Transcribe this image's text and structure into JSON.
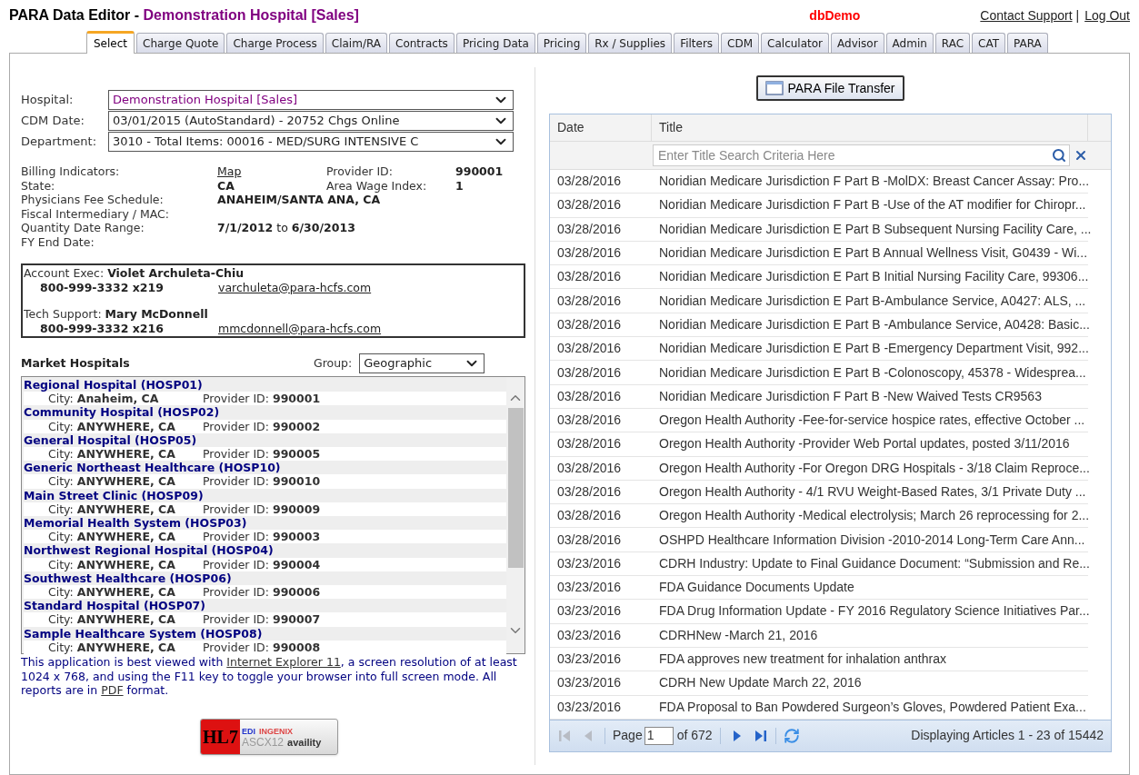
{
  "header": {
    "app_title": "PARA Data Editor - ",
    "hospital_title": "Demonstration Hospital [Sales]",
    "database": "dbDemo",
    "links": [
      {
        "label": "Contact Support"
      },
      {
        "label": "|",
        "kind": "separator"
      },
      {
        "label": "Log Out"
      }
    ]
  },
  "tabs": [
    {
      "label": "Select",
      "selected": true
    },
    {
      "label": "Charge Quote",
      "selected": false
    },
    {
      "label": "Charge Process",
      "selected": false
    },
    {
      "label": "Claim/RA",
      "selected": false
    },
    {
      "label": "Contracts",
      "selected": false
    },
    {
      "label": "Pricing Data",
      "selected": false
    },
    {
      "label": "Pricing",
      "selected": false
    },
    {
      "label": "Rx / Supplies",
      "selected": false
    },
    {
      "label": "Filters",
      "selected": false
    },
    {
      "label": "CDM",
      "selected": false
    },
    {
      "label": "Calculator",
      "selected": false
    },
    {
      "label": "Advisor",
      "selected": false
    },
    {
      "label": "Admin",
      "selected": false
    },
    {
      "label": "RAC",
      "selected": false
    },
    {
      "label": "CAT",
      "selected": false
    },
    {
      "label": "PARA",
      "selected": false
    }
  ],
  "selectors": [
    {
      "label": "Hospital:",
      "value": "Demonstration Hospital [Sales]",
      "kind": "hospital"
    },
    {
      "label": "CDM Date:",
      "value": "03/01/2015 (AutoStandard) - 20752 Chgs Online",
      "kind": "plain"
    },
    {
      "label": "Department:",
      "value": "3010 - Total Items: 00016 - MED/SURG INTENSIVE C",
      "kind": "plain"
    }
  ],
  "info": {
    "rows": [
      {
        "label": "Billing Indicators:",
        "value": "Map",
        "kind": "link",
        "side_label": "Provider ID:",
        "side_value": "990001"
      },
      {
        "label": "State:",
        "value": "CA",
        "kind": "bold",
        "side_label": "Area Wage Index:",
        "side_value": "1"
      },
      {
        "label": "Physicians Fee Schedule:",
        "value": "ANAHEIM/SANTA ANA, CA",
        "kind": "bold"
      },
      {
        "label": "Fiscal Intermediary / MAC:"
      },
      {
        "label": "Quantity Date Range:",
        "value": "**7/1/2012** to **6/30/2013**",
        "kind": "rich"
      },
      {
        "label": "FY End Date:"
      }
    ]
  },
  "contacts": [
    {
      "role": "Account Exec:",
      "name": "Violet Archuleta-Chiu",
      "phone": "800-999-3332 x219",
      "email": "varchuleta@para-hcfs.com"
    },
    {
      "role": "Tech Support:",
      "name": "Mary McDonnell",
      "phone": "800-999-3332 x216",
      "email": "mmcdonnell@para-hcfs.com"
    }
  ],
  "market": {
    "title": "Market Hospitals",
    "group_label": "Group:",
    "group_value": "Geographic",
    "hospitals": [
      {
        "name": "Regional Hospital (HOSP01)",
        "city_label": "City:",
        "city": "Anaheim, CA",
        "provider_label": "Provider ID:",
        "provider_id": "990001"
      },
      {
        "name": "Community Hospital (HOSP02)",
        "city_label": "City:",
        "city": "ANYWHERE, CA",
        "provider_label": "Provider ID:",
        "provider_id": "990002"
      },
      {
        "name": "General Hospital (HOSP05)",
        "city_label": "City:",
        "city": "ANYWHERE, CA",
        "provider_label": "Provider ID:",
        "provider_id": "990005"
      },
      {
        "name": "Generic Northeast Healthcare (HOSP10)",
        "city_label": "City:",
        "city": "ANYWHERE, CA",
        "provider_label": "Provider ID:",
        "provider_id": "990010"
      },
      {
        "name": "Main Street Clinic (HOSP09)",
        "city_label": "City:",
        "city": "ANYWHERE, CA",
        "provider_label": "Provider ID:",
        "provider_id": "990009"
      },
      {
        "name": "Memorial Health System (HOSP03)",
        "city_label": "City:",
        "city": "ANYWHERE, CA",
        "provider_label": "Provider ID:",
        "provider_id": "990003"
      },
      {
        "name": "Northwest Regional Hospital (HOSP04)",
        "city_label": "City:",
        "city": "ANYWHERE, CA",
        "provider_label": "Provider ID:",
        "provider_id": "990004"
      },
      {
        "name": "Southwest Healthcare (HOSP06)",
        "city_label": "City:",
        "city": "ANYWHERE, CA",
        "provider_label": "Provider ID:",
        "provider_id": "990006"
      },
      {
        "name": "Standard Hospital (HOSP07)",
        "city_label": "City:",
        "city": "ANYWHERE, CA",
        "provider_label": "Provider ID:",
        "provider_id": "990007"
      },
      {
        "name": "Sample Healthcare System (HOSP08)",
        "city_label": "City:",
        "city": "ANYWHERE, CA",
        "provider_label": "Provider ID:",
        "provider_id": "990008"
      }
    ]
  },
  "note": [
    {
      "text": "This application is best viewed with "
    },
    {
      "text": "Internet Explorer 11",
      "kind": "link"
    },
    {
      "text": ", a screen resolution of at least 1024 x 768, and using the F11 key to toggle your browser into full screen mode. All reports are in "
    },
    {
      "text": "PDF",
      "kind": "link"
    },
    {
      "text": " format."
    }
  ],
  "logos": [
    "HL7",
    "EDI",
    "INGENIX",
    "ASCX12",
    "availity"
  ],
  "transfer_button": "PARA File Transfer",
  "articles": {
    "columns": [
      "Date",
      "Title"
    ],
    "search_placeholder": "Enter Title Search Criteria Here",
    "rows": [
      {
        "date": "03/28/2016",
        "title": "Noridian Medicare Jurisdiction F Part B -MolDX: Breast Cancer Assay: Pro..."
      },
      {
        "date": "03/28/2016",
        "title": "Noridian Medicare Jurisdiction F Part B -Use of the AT modifier for Chiropr..."
      },
      {
        "date": "03/28/2016",
        "title": "Noridian Medicare Jurisdiction E Part B Subsequent Nursing Facility Care, ..."
      },
      {
        "date": "03/28/2016",
        "title": "Noridian Medicare Jurisdiction E Part B Annual Wellness Visit, G0439 - Wi..."
      },
      {
        "date": "03/28/2016",
        "title": "Noridian Medicare Jurisdiction E Part B Initial Nursing Facility Care, 99306..."
      },
      {
        "date": "03/28/2016",
        "title": "Noridian Medicare Jurisdiction E Part B-Ambulance Service, A0427: ALS, ..."
      },
      {
        "date": "03/28/2016",
        "title": "Noridian Medicare Jurisdiction E Part B -Ambulance Service, A0428: Basic..."
      },
      {
        "date": "03/28/2016",
        "title": "Noridian Medicare Jurisdiction E Part B -Emergency Department Visit, 992..."
      },
      {
        "date": "03/28/2016",
        "title": "Noridian Medicare Jurisdiction E Part B -Colonoscopy, 45378 - Widesprea..."
      },
      {
        "date": "03/28/2016",
        "title": "Noridian Medicare Jurisdiction F Part B -New Waived Tests CR9563"
      },
      {
        "date": "03/28/2016",
        "title": "Oregon Health Authority -Fee-for-service hospice rates, effective October ..."
      },
      {
        "date": "03/28/2016",
        "title": "Oregon Health Authority -Provider Web Portal updates, posted 3/11/2016"
      },
      {
        "date": "03/28/2016",
        "title": "Oregon Health Authority -For Oregon DRG Hospitals - 3/18 Claim Reproce..."
      },
      {
        "date": "03/28/2016",
        "title": "Oregon Health Authority - 4/1 RVU Weight-Based Rates, 3/1 Private Duty ..."
      },
      {
        "date": "03/28/2016",
        "title": "Oregon Health Authority -Medical electrolysis; March 26 reprocessing for 2..."
      },
      {
        "date": "03/28/2016",
        "title": "OSHPD Healthcare Information Division -2010-2014 Long-Term Care Ann..."
      },
      {
        "date": "03/23/2016",
        "title": "CDRH Industry: Update to Final Guidance Document: “Submission and Re..."
      },
      {
        "date": "03/23/2016",
        "title": "FDA Guidance Documents Update"
      },
      {
        "date": "03/23/2016",
        "title": "FDA Drug Information Update - FY 2016 Regulatory Science Initiatives Par..."
      },
      {
        "date": "03/23/2016",
        "title": "CDRHNew -March 21, 2016"
      },
      {
        "date": "03/23/2016",
        "title": "FDA approves new treatment for inhalation anthrax"
      },
      {
        "date": "03/23/2016",
        "title": "CDRH New Update March 22, 2016"
      },
      {
        "date": "03/23/2016",
        "title": "FDA Proposal to Ban Powdered Surgeon’s Gloves, Powdered Patient Exa..."
      }
    ],
    "pager": {
      "page_label": "Page",
      "page": "1",
      "of_label": "of 672",
      "status": "Displaying Articles 1 - 23 of 15442",
      "buttons": [
        {
          "kind": "first",
          "disabled": true
        },
        {
          "kind": "prev",
          "disabled": true
        },
        {
          "kind": "next",
          "disabled": false
        },
        {
          "kind": "last",
          "disabled": false
        }
      ]
    }
  }
}
